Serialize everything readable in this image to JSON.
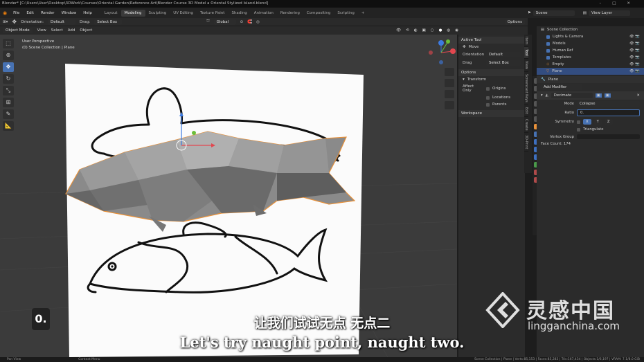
{
  "window": {
    "title": "Blender* [C:\\Users\\User\\Desktop\\3DWork\\Courses\\Oriental Garden\\Reference Art\\Blender Course 3D Model a Oriental Stylized Island.blend]"
  },
  "menu": {
    "items": [
      "File",
      "Edit",
      "Render",
      "Window",
      "Help"
    ],
    "workspaces": [
      "Layout",
      "Modeling",
      "Sculpting",
      "UV Editing",
      "Texture Paint",
      "Shading",
      "Animation",
      "Rendering",
      "Compositing",
      "Scripting"
    ],
    "active_workspace": "Modeling",
    "scene": "Scene",
    "view_layer": "View Layer"
  },
  "header": {
    "orientation_label": "Orientation:",
    "orientation_value": "Default",
    "drag_label": "Drag:",
    "drag_value": "Select Box",
    "transform_orientation": "Global",
    "options": "Options"
  },
  "header2": {
    "mode": "Object Mode",
    "menus": [
      "View",
      "Select",
      "Add",
      "Object"
    ]
  },
  "viewport": {
    "perspective": "User Perspective",
    "collection": "(0) Scene Collection | Plane"
  },
  "npanel": {
    "active_tool": "Active Tool",
    "tool_name": "Move",
    "orientation_label": "Orientation",
    "orientation_value": "Default",
    "drag_label": "Drag",
    "drag_value": "Select Box",
    "options": "Options",
    "transform": "Transform",
    "affect_only": "Affect Only",
    "origins": "Origins",
    "locations": "Locations",
    "parents": "Parents",
    "workspace": "Workspace",
    "tabs": [
      "Item",
      "Tool",
      "View",
      "Screencast Keys",
      "Edit",
      "Create",
      "3D-Print"
    ]
  },
  "outliner": {
    "root": "Scene Collection",
    "items": [
      "Lights & Camera",
      "Models",
      "Human Ref",
      "Templates",
      "Empty",
      "Plane"
    ],
    "selected": "Plane"
  },
  "properties": {
    "object": "Plane",
    "add_modifier": "Add Modifier",
    "modifier_name": "Decimate",
    "mode_label": "Mode",
    "mode_value": "Collapse",
    "ratio_label": "Ratio",
    "ratio_value": "0.",
    "symmetry_label": "Symmetry",
    "axes": [
      "X",
      "Y",
      "Z"
    ],
    "triangulate": "Triangulate",
    "vertex_group_label": "Vertex Group",
    "face_count": "Face Count: 174"
  },
  "status": {
    "left": "Pan View",
    "mid": "Context Menu",
    "right": "Scene Collection | Plane | Verts:85,153 | Faces:85,283 | Tris:167,434 | Objects:1/6,197 | VRAM: 7.1/8.0 GiB"
  },
  "overlay": {
    "key": "0.",
    "subtitle_zh": "让我们试试无点 无点二",
    "subtitle_en": "Let's try naught point, naught two.",
    "watermark_zh": "灵感中国",
    "watermark_en": "lingganchina.com"
  },
  "colors": {
    "accent": "#4772b3",
    "selected_outline": "#e8913a",
    "viewport_bg": "#3b3b3b"
  }
}
